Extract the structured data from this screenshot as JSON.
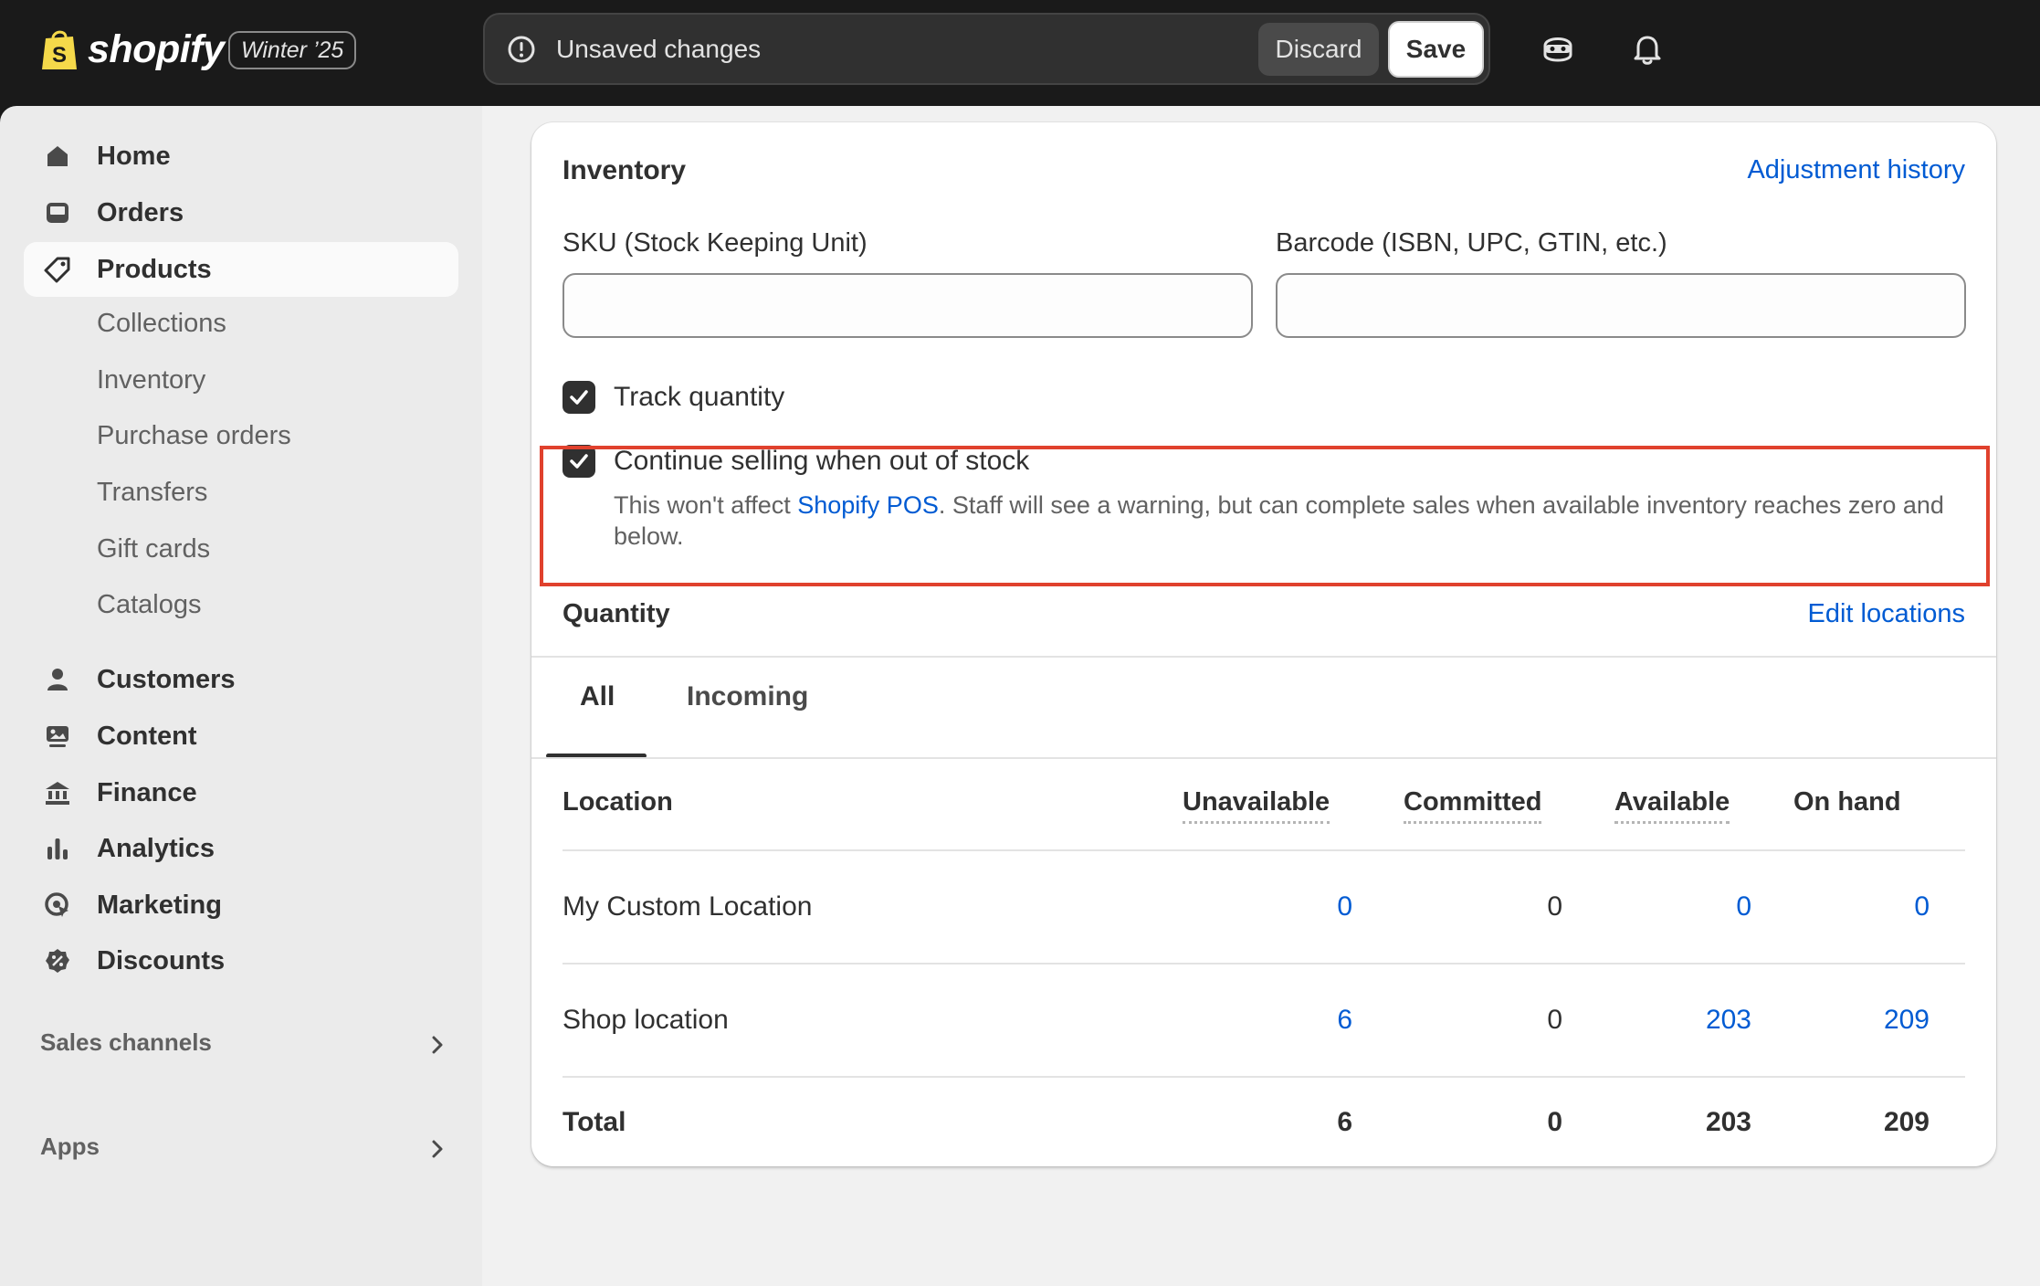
{
  "topbar": {
    "logo_text": "shopify",
    "edition": "Winter ’25",
    "unsaved_message": "Unsaved changes",
    "discard_label": "Discard",
    "save_label": "Save"
  },
  "sidebar": {
    "main_items": [
      {
        "label": "Home",
        "icon": "home-icon"
      },
      {
        "label": "Orders",
        "icon": "inbox-icon"
      },
      {
        "label": "Products",
        "icon": "tag-icon",
        "active": true
      }
    ],
    "product_subitems": [
      "Collections",
      "Inventory",
      "Purchase orders",
      "Transfers",
      "Gift cards",
      "Catalogs"
    ],
    "other_items": [
      {
        "label": "Customers",
        "icon": "person-icon"
      },
      {
        "label": "Content",
        "icon": "image-icon"
      },
      {
        "label": "Finance",
        "icon": "bank-icon"
      },
      {
        "label": "Analytics",
        "icon": "bar-chart-icon"
      },
      {
        "label": "Marketing",
        "icon": "target-icon"
      },
      {
        "label": "Discounts",
        "icon": "discount-icon"
      }
    ],
    "sales_channels_label": "Sales channels",
    "apps_label": "Apps"
  },
  "inventory": {
    "title": "Inventory",
    "adjustment_history_link": "Adjustment history",
    "sku_label": "SKU (Stock Keeping Unit)",
    "sku_value": "",
    "barcode_label": "Barcode (ISBN, UPC, GTIN, etc.)",
    "barcode_value": "",
    "track_quantity_label": "Track quantity",
    "track_quantity_checked": true,
    "continue_selling_label": "Continue selling when out of stock",
    "continue_selling_checked": true,
    "help_prefix": "This won't affect ",
    "help_link": "Shopify POS",
    "help_suffix": ". Staff will see a warning, but can complete sales when available inventory reaches zero and below."
  },
  "quantity": {
    "title": "Quantity",
    "edit_locations_link": "Edit locations",
    "tabs": [
      "All",
      "Incoming"
    ],
    "selected_tab": "All",
    "columns": [
      "Location",
      "Unavailable",
      "Committed",
      "Available",
      "On hand"
    ],
    "rows": [
      {
        "location": "My Custom Location",
        "unavailable": "0",
        "committed": "0",
        "available": "0",
        "on_hand": "0"
      },
      {
        "location": "Shop location",
        "unavailable": "6",
        "committed": "0",
        "available": "203",
        "on_hand": "209"
      }
    ],
    "total": {
      "label": "Total",
      "unavailable": "6",
      "committed": "0",
      "available": "203",
      "on_hand": "209"
    }
  },
  "colors": {
    "accent_link": "#005bd3",
    "highlight_border": "#e0412d",
    "topbar_bg": "#1a1a1a"
  }
}
